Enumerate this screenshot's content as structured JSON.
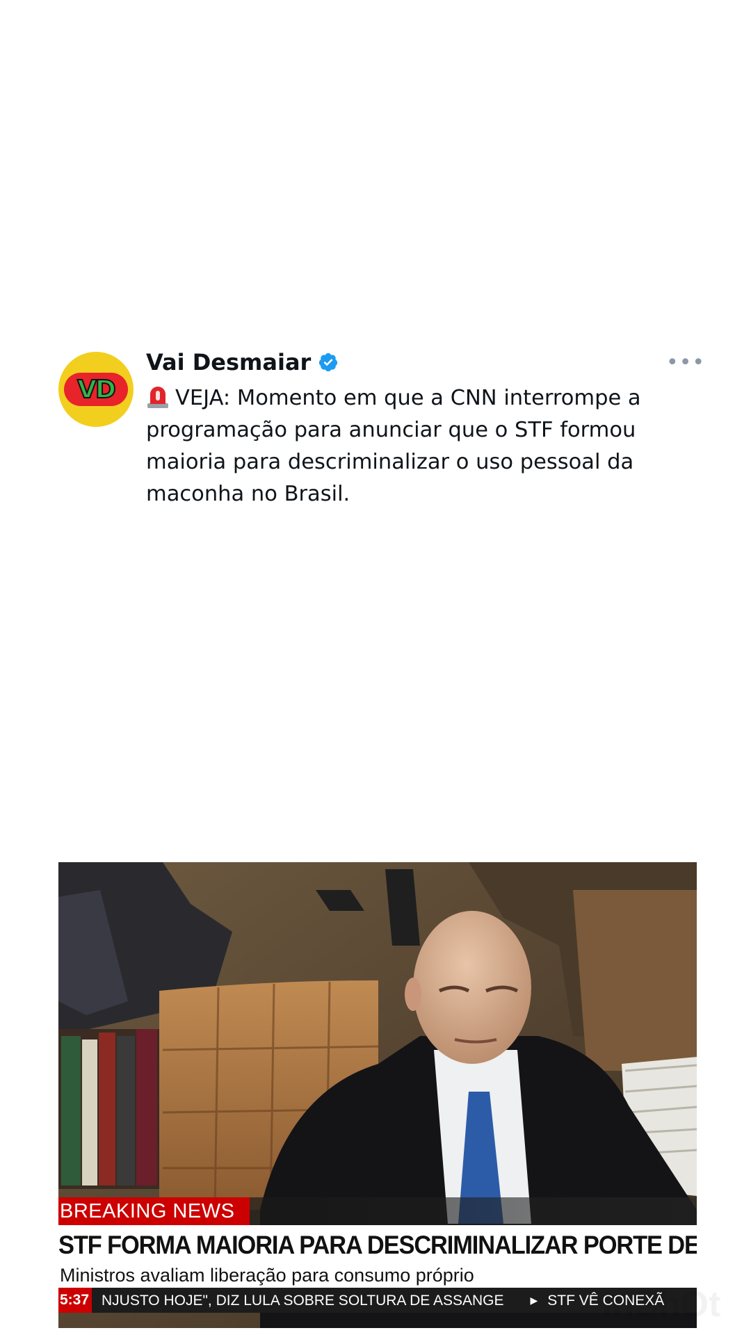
{
  "tweet": {
    "author_name": "Vai Desmaiar",
    "avatar_text": "VD",
    "more_label": "•••",
    "text": "VEJA: Momento em que a CNN interrompe a programação para anunciar que o STF formou maioria para descriminalizar o uso pessoal da maconha no Brasil."
  },
  "video": {
    "breaking_label": "BREAKING NEWS",
    "headline": "STF FORMA MAIORIA PARA DESCRIMINALIZAR PORTE DE MACONHA",
    "subheadline": "Ministros avaliam liberação para consumo próprio",
    "ticker_time": "5:37",
    "ticker_item_1": "NJUSTO HOJE\", DIZ LULA SOBRE SOLTURA DE ASSANGE",
    "ticker_item_2": "STF VÊ CONEXÃ"
  },
  "watermark": "InShOt",
  "colors": {
    "breaking_red": "#cc0000",
    "verified_blue": "#1d9bf0",
    "avatar_yellow": "#f2cf1f"
  }
}
